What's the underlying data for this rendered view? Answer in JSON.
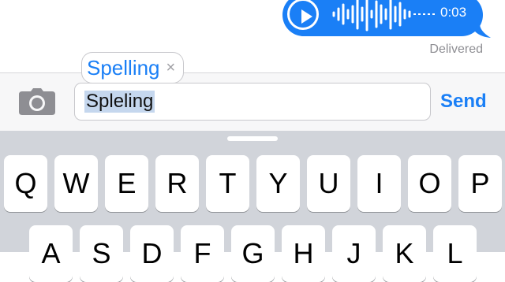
{
  "message": {
    "duration": "0:03",
    "status": "Delivered",
    "play_icon": "play-icon",
    "bubble_color": "#1a7ff6"
  },
  "compose": {
    "camera_icon": "camera-icon",
    "input_value": "Spleling",
    "send_label": "Send"
  },
  "suggestion": {
    "word": "Spelling",
    "dismiss_symbol": "×"
  },
  "keyboard": {
    "row1": [
      "Q",
      "W",
      "E",
      "R",
      "T",
      "Y",
      "U",
      "I",
      "O",
      "P"
    ],
    "row2": [
      "A",
      "S",
      "D",
      "F",
      "G",
      "H",
      "J",
      "K",
      "L"
    ]
  }
}
